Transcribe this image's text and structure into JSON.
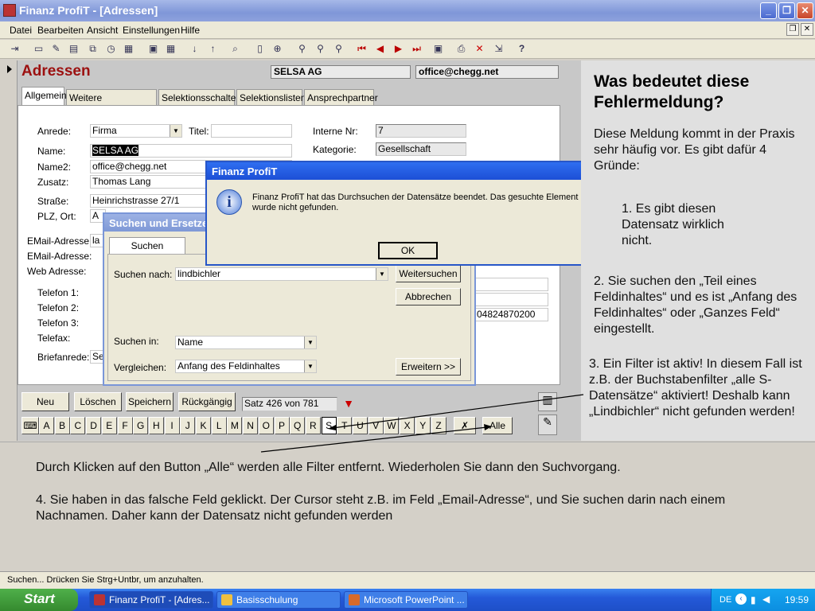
{
  "window": {
    "title": "Finanz ProfiT - [Adressen]"
  },
  "menu": [
    "Datei",
    "Bearbeiten",
    "Ansicht",
    "Einstellungen",
    "Hilfe"
  ],
  "form": {
    "heading": "Adressen",
    "header_name": "SELSA AG",
    "header_email": "office@chegg.net",
    "tabs": [
      "Allgemein",
      "Weitere Informationen",
      "Selektionsschalter",
      "Selektionslisten",
      "Ansprechpartner"
    ],
    "labels": {
      "anrede": "Anrede:",
      "titel": "Titel:",
      "name": "Name:",
      "name2": "Name2:",
      "zusatz": "Zusatz:",
      "strasse": "Straße:",
      "plz": "PLZ, Ort:",
      "email1": "EMail-Adresse:",
      "email2": "EMail-Adresse:",
      "web": "Web Adresse:",
      "tel1": "Telefon 1:",
      "tel2": "Telefon 2:",
      "tel3": "Telefon 3:",
      "telefax": "Telefax:",
      "briefanrede": "Briefanrede:",
      "interne_nr": "Interne Nr:",
      "kategorie": "Kategorie:"
    },
    "values": {
      "anrede": "Firma",
      "name": "SELSA AG",
      "name2": "office@chegg.net",
      "zusatz": "Thomas Lang",
      "strasse": "Heinrichstrasse 27/1",
      "plz": "A",
      "email1": "la",
      "briefanrede": "Se",
      "interne_nr": "7",
      "kategorie": "Gesellschaft",
      "phone_partial": "04824870200"
    },
    "buttons": {
      "neu": "Neu",
      "loeschen": "Löschen",
      "speichern": "Speichern",
      "rueckgaengig": "Rückgängig",
      "alle": "Alle"
    },
    "record_counter": "Satz 426 von 781",
    "letters": [
      "A",
      "B",
      "C",
      "D",
      "E",
      "F",
      "G",
      "H",
      "I",
      "J",
      "K",
      "L",
      "M",
      "N",
      "O",
      "P",
      "Q",
      "R",
      "S",
      "T",
      "U",
      "V",
      "W",
      "X",
      "Y",
      "Z"
    ]
  },
  "search_dialog": {
    "title": "Suchen und Ersetzen",
    "tab": "Suchen",
    "search_label": "Suchen nach:",
    "search_value": "lindbichler",
    "in_label": "Suchen in:",
    "in_value": "Name",
    "compare_label": "Vergleichen:",
    "compare_value": "Anfang des Feldinhaltes",
    "btn_next": "Weitersuchen",
    "btn_cancel": "Abbrechen",
    "btn_more": "Erweitern >>"
  },
  "message_dialog": {
    "title": "Finanz ProfiT",
    "text": "Finanz ProfiT hat das Durchsuchen der Datensätze beendet. Das gesuchte Element wurde nicht gefunden.",
    "ok": "OK"
  },
  "notes": {
    "heading": "Was bedeutet diese Fehlermeldung?",
    "intro": "Diese Meldung kommt in der Praxis sehr häufig vor. Es gibt dafür 4 Gründe:",
    "p1": "1. Es gibt diesen Datensatz wirklich nicht.",
    "p2": "2. Sie suchen den „Teil eines Feldinhaltes“ und es ist „Anfang des Feldinhaltes“ oder „Ganzes Feld“ eingestellt.",
    "p3": "3. Ein Filter ist aktiv! In diesem Fall ist z.B. der Buchstabenfilter „alle S-Datensätze“ aktiviert! Deshalb kann „Lindbichler“ nicht gefunden werden!",
    "bottom1": "Durch Klicken auf den Button „Alle“ werden alle Filter entfernt. Wiederholen Sie dann den Suchvorgang.",
    "bottom2": "4. Sie haben in das falsche Feld geklickt. Der Cursor steht z.B. im Feld „Email-Adresse“, und Sie suchen darin nach einem Nachnamen. Daher kann der Datensatz nicht gefunden werden"
  },
  "statusbar": "Suchen... Drücken Sie Strg+Untbr, um anzuhalten.",
  "taskbar": {
    "start": "Start",
    "tasks": [
      "Finanz ProfiT - [Adres...",
      "Basisschulung",
      "Microsoft PowerPoint ..."
    ],
    "lang": "DE",
    "clock": "19:59"
  }
}
